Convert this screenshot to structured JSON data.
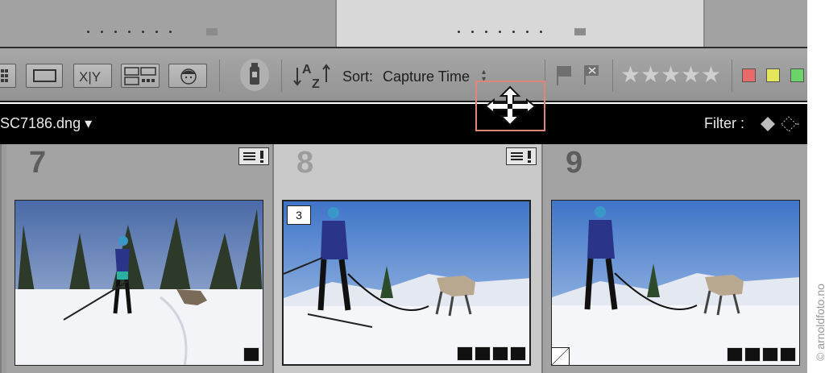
{
  "toolbar": {
    "sort_label": "Sort:",
    "sort_value": "Capture Time",
    "sort_az_icon": "sort-az-icon"
  },
  "filter_bar": {
    "filename": "SC7186.dng ▾",
    "filter_label": "Filter :"
  },
  "cells": [
    {
      "number": "7"
    },
    {
      "number": "8",
      "stack_count": "3"
    },
    {
      "number": "9"
    }
  ],
  "label_colors": [
    "#e86a6a",
    "#e6e65a",
    "#6ad46a"
  ],
  "watermark": "© arnoldfoto.no"
}
